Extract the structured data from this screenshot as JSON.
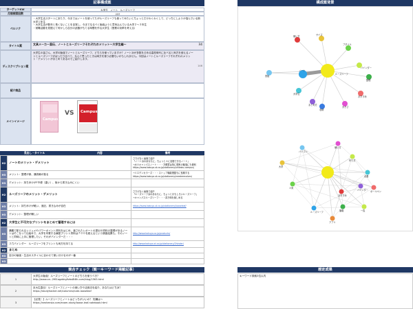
{
  "left": {
    "title": "記事構成案",
    "fields": [
      {
        "label": "ターゲットKW",
        "value": "大学生　ノート　ルーズリーフ"
      },
      {
        "label": "月間検索回数",
        "value": "237"
      },
      {
        "label": "ペルソナ",
        "value": "・大学生活スタートにあたり、今まではノートを使ってたがルーズリーフも使ってみたいとちょっとだけわくわくして、どっちにしようか悩んでいる新大学１年生\n・大学生活が数年と長くないことを自覚し、今までなるべく勉強ようと意気込んでいる大学２～３年生\n・就職活動を見据えて何かしら自分の武器がもてる時間を作る大学生（授業の効率を考える）"
      },
      {
        "label": "タイトル案",
        "value": "文具メーカー直伝、ノートとルーズリーフそれぞれのメリット～大学生編～",
        "count": "34"
      },
      {
        "label": "ディスクリプション案",
        "value": "大学生の皆さん、大学の勉強でノートとルーズリーフ、どちらを使っていますか？ノート派が多数を占める高校時代に比べると両方を使えるノートとルーズリーフがばったり比べて、なんて思ったときは両方を使う必要もいかもしれません。今回はノートとルーズリーフそれぞれのメリット・デメリットがまとめてあるのでご紹介します。",
        "count": "146"
      },
      {
        "label": "紹介商品",
        "value": ""
      },
      {
        "label": "メインイメージ",
        "value": ""
      }
    ],
    "vs_text": "VS",
    "product_a_text": "Campus",
    "product_b_text": "Campus"
  },
  "outline": {
    "col_heading": "見出し・タイトル",
    "col_content": "内容",
    "col_remarks": "備考",
    "rows": [
      {
        "tag": "H2",
        "text": "ノートのメリット・デメリット",
        "remarks": "さりげなく画像で紹介\n「ノート派のあなたに、ちょっと人に自慢できるノート」\n→大人キャンパスノート・・・方眼罫は特に理系の勉強にも便利\nhttps://www.kokuyo-st.co.jp/stationery/shikaku-campus/",
        "bold": true
      },
      {
        "tag": "H3",
        "text": "メリット：整理が楽、通読最が高る",
        "remarks": "→リエデンカラーズ・・・ストップ機能搭載もに長期する\nhttps://www.kokuyo-st.co.jp/stationery/neederecolors/"
      },
      {
        "tag": "H3",
        "text": "デメリット：持ち歩けがF不便（重い）、後から書き込みにくい",
        "remarks": ""
      },
      {
        "tag": "H2",
        "text": "ルーズリーフのメリット・デメリット",
        "remarks": "さりげなく画像で紹介\n「ルーズリーフ派のあなたに、ちょっとおもしろいルーズリーフ」\n→キャンパスルーズリーフ・・・書き味を楽しめる",
        "bold": true
      },
      {
        "tag": "H3",
        "text": "メリット：持ち歩けが軽い、追記、書き込みが自在",
        "remarks": "https://www.kokuyo-st.co.jp/stationery/looseleaf/"
      },
      {
        "tag": "H3",
        "text": "デメリット：整理が難しい",
        "remarks": ""
      },
      {
        "tag": "H2",
        "text": "大学生に不可欠なプリントをまとめて管理するには",
        "remarks": "",
        "bold": true
      },
      {
        "tag": "H3",
        "text": "講義で配られるレジュメやパワーポイント資料をはじめ、渡されたレポートの提出や資料の整理があるノートはそこなって仕組みで、大学を卒業する練習プリント資料は７００を超えるという調査結果も。そのノートと同時に上手に管理したい、それがバインダーだ・・・",
        "remarks": "http://www.kokuyo.co.jp/products/"
      },
      {
        "tag": "H3",
        "text": "２穴バインダー　ルーズリーフをプリントも両方を持てる",
        "remarks": "http://www.kokuyo-st.co.jp/stationery/2hinder/"
      },
      {
        "tag": "H2",
        "text": "まとめ",
        "remarks": "",
        "bold": true
      },
      {
        "tag": "H3",
        "text": "自分の勉強・生活のスタイルに合わせて使い分けるのが一番",
        "remarks": ""
      },
      {
        "tag": "H3",
        "text": "",
        "remarks": ""
      }
    ]
  },
  "competitors": {
    "title": "競合チェック（競ーキーワード掲載記事）",
    "rows": [
      {
        "num": "1",
        "title": "大学生の勉強！ルーズリーフとノートのどちらを使うべき？",
        "url": "http://www.xn--2f61agzbkg9zbs8t8h.com/blog/1563.html"
      },
      {
        "num": "2",
        "title": "京大生直伝！ルーズリーフとノートの使い方や活用法を紹介、あなたはどち派？",
        "url": "https://studyhacker.net/columns/note-looseleaf"
      },
      {
        "num": "3",
        "title": "【必見！】ルーズリーフとノートはどっちがいいの？ 知識は～",
        "url": "https://nextensia.com/exam-study/loose-leaf-notebook.html"
      }
    ]
  },
  "right": {
    "graph_title": "構成案背景",
    "memo_title": "想定成果",
    "memo_text": "キーワード検索3位以内",
    "graph1": {
      "center": "ルーズリーフ",
      "nodes": [
        "使い方",
        "サイズ",
        "ブダイル",
        "バインダー",
        "整理",
        "おすすめ",
        "大きさ",
        "収納",
        "まとめ方",
        "大学生",
        "ノート",
        "黒板"
      ]
    },
    "graph2": {
      "nodes": [
        "バリコン",
        "使い方",
        "大学",
        "人気",
        "必要",
        "作り方",
        "バインダー",
        "ボールペン",
        "おすすめ",
        "ルーズリーフ",
        "アプリ",
        "筆箱",
        "一覧"
      ]
    }
  }
}
